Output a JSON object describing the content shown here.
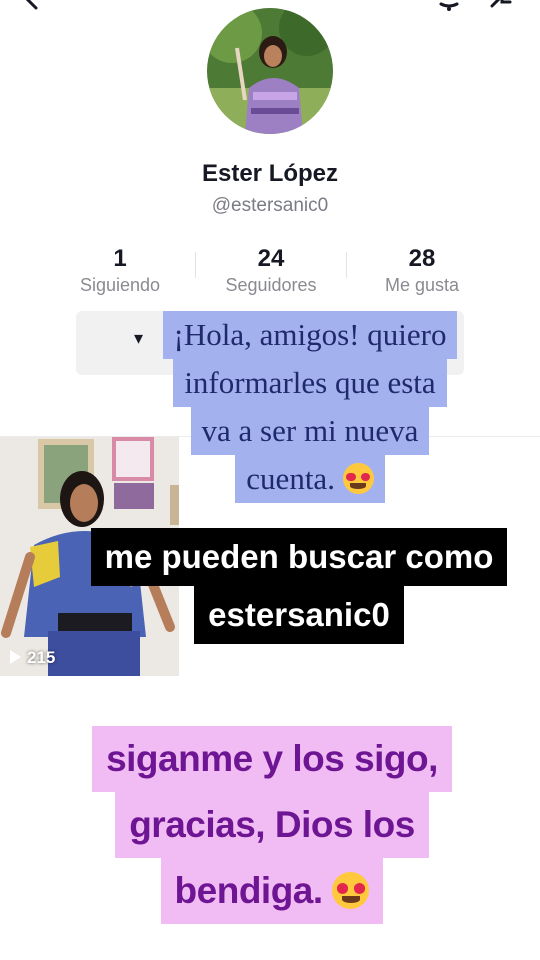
{
  "profile": {
    "name": "Ester López",
    "handle": "@estersanic0"
  },
  "stats": [
    {
      "value": "1",
      "label": "Siguiendo"
    },
    {
      "value": "24",
      "label": "Seguidores"
    },
    {
      "value": "28",
      "label": "Me gusta"
    }
  ],
  "video": {
    "views": "215"
  },
  "captions": {
    "blue": [
      "¡Hola, amigos! quiero",
      "informarles que esta",
      "va a ser mi nueva",
      "cuenta."
    ],
    "black": [
      "me pueden buscar como",
      "estersanic0"
    ],
    "pink": [
      "siganme y los sigo,",
      "gracias, Dios los",
      "bendiga."
    ]
  },
  "icons": {
    "top_left": "back-arrow-icon",
    "top_right_1": "bell-icon",
    "top_right_2": "share-icon",
    "follow_dropdown": "chevron-down-icon",
    "views": "play-icon",
    "emoji": "heart-eyes-emoji"
  },
  "colors": {
    "blue_caption_bg": "#a3b2ee",
    "blue_caption_text": "#1f2a6e",
    "black_caption_bg": "#000000",
    "pink_caption_bg": "#f0bcf3",
    "pink_caption_text": "#6e1593"
  }
}
